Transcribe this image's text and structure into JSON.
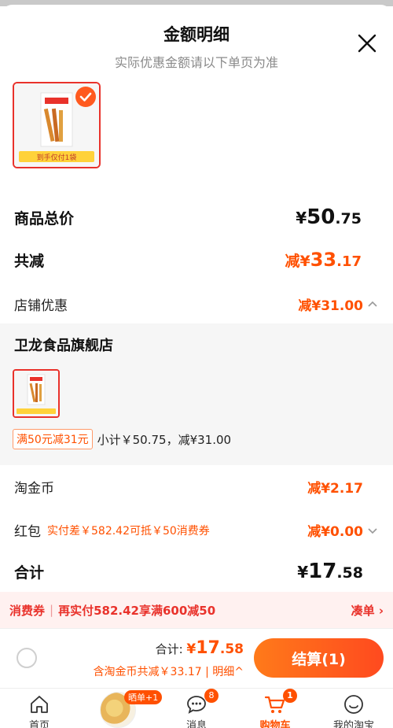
{
  "header": {
    "title": "金额明细",
    "subtitle": "实际优惠金额请以下单页为准"
  },
  "product_badge_text": "到手仅付1袋",
  "summary": {
    "goods_total_label": "商品总价",
    "goods_total": {
      "cur": "¥",
      "int": "50",
      "dec": ".75"
    },
    "total_reduce_label": "共减",
    "total_reduce": {
      "prefix": "减",
      "cur": "¥",
      "int": "33",
      "dec": ".17"
    },
    "store_discount_label": "店铺优惠",
    "store_discount": "减¥31.00"
  },
  "store": {
    "name": "卫龙食品旗舰店",
    "promo_tag": "满50元减31元",
    "subtotal": "小计￥50.75，减¥31.00"
  },
  "extras": {
    "coin_label": "淘金币",
    "coin_value": "减¥2.17",
    "redpack_label": "红包",
    "redpack_note": "实付差￥582.42可抵￥50消费券",
    "redpack_value": "减¥0.00",
    "sum_label": "合计",
    "sum": {
      "cur": "¥",
      "int": "17",
      "dec": ".58"
    }
  },
  "coupon_bar": {
    "tag": "消费券",
    "text": "再实付582.42享满600减50",
    "action": "凑单 ›"
  },
  "checkout": {
    "total_prefix": "合计: ",
    "total": {
      "cur": "¥",
      "int": "17",
      "dec": ".58"
    },
    "sub": "含淘金币共减￥33.17 | 明细^",
    "pay_label": "结算(1)"
  },
  "tabbar": {
    "home": "首页",
    "share_pill": "晒单+1",
    "messages": "消息",
    "messages_badge": "8",
    "cart": "购物车",
    "cart_badge": "1",
    "mine": "我的淘宝"
  },
  "colors": {
    "accent": "#ff5000",
    "red": "#e9322b"
  }
}
